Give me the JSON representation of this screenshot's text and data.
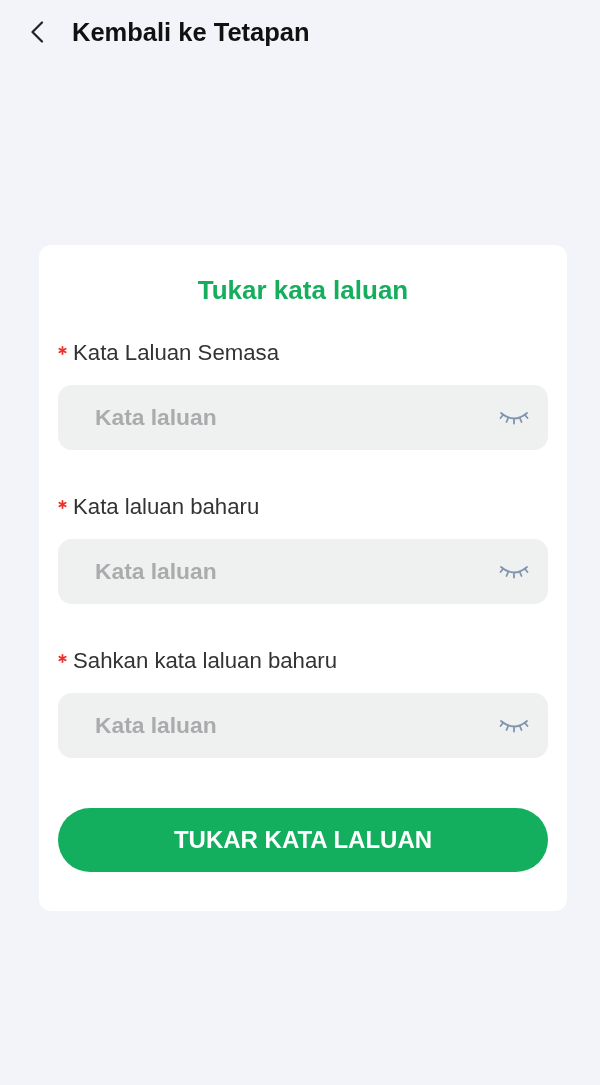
{
  "header": {
    "back_label": "Kembali ke Tetapan"
  },
  "card": {
    "title": "Tukar kata laluan",
    "fields": [
      {
        "label": "Kata Laluan Semasa",
        "required": true,
        "placeholder": "Kata laluan",
        "password_visible": false
      },
      {
        "label": "Kata laluan baharu",
        "required": true,
        "placeholder": "Kata laluan",
        "password_visible": false
      },
      {
        "label": "Sahkan kata laluan baharu",
        "required": true,
        "placeholder": "Kata laluan",
        "password_visible": false
      }
    ],
    "submit_button": "TUKAR KATA LALUAN"
  }
}
